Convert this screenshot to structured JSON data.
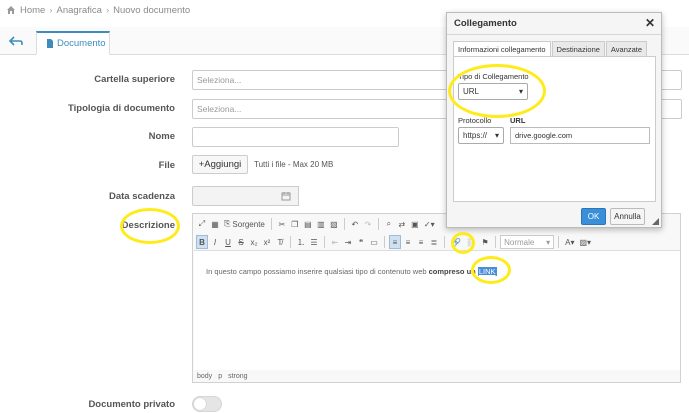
{
  "breadcrumb": {
    "home": "Home",
    "section": "Anagrafica",
    "current": "Nuovo documento"
  },
  "tab": {
    "label": "Documento"
  },
  "form": {
    "cartella_label": "Cartella superiore",
    "cartella_placeholder": "Seleziona...",
    "tipologia_label": "Tipologia di documento",
    "tipologia_placeholder": "Seleziona...",
    "nome_label": "Nome",
    "file_label": "File",
    "add_button": "+Aggiungi",
    "file_hint": "Tutti i file - Max 20 MB",
    "scadenza_label": "Data scadenza",
    "descrizione_label": "Descrizione",
    "privato_label": "Documento privato"
  },
  "editor": {
    "source_label": "Sorgente",
    "format_select": "Normale",
    "text_before": "In questo campo possiamo inserire qualsiasi tipo di contenuto web ",
    "text_bold": "compreso un",
    "text_link": "LINK",
    "path": [
      "body",
      "p",
      "strong"
    ]
  },
  "dialog": {
    "title": "Collegamento",
    "tabs": [
      "Informazioni collegamento",
      "Destinazione",
      "Avanzate"
    ],
    "tipo_label": "Tipo di Collegamento",
    "tipo_value": "URL",
    "protocollo_label": "Protocollo",
    "protocollo_value": "https://",
    "url_label": "URL",
    "url_value": "drive.google.com",
    "ok_label": "OK",
    "cancel_label": "Annulla"
  },
  "colors": {
    "accent": "#3c8dbc",
    "annotation": "#ffeb1a",
    "ok_button": "#3a8fd9"
  }
}
